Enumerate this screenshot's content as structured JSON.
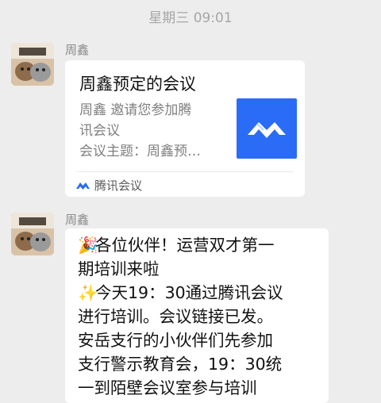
{
  "timestamp": "星期三 09:01",
  "messages": [
    {
      "sender": "周鑫",
      "card": {
        "title": "周鑫预定的会议",
        "desc_lines": [
          "周鑫 邀请您参加腾",
          "讯会议",
          "会议主题：周鑫预…"
        ],
        "source": "腾讯会议",
        "thumb_icon": "tencent-meeting-logo",
        "brand_color": "#2b6cf6"
      }
    },
    {
      "sender": "周鑫",
      "text_lines": [
        {
          "emoji": "🎉",
          "text": "各位伙伴！运营双才第一"
        },
        {
          "emoji": "",
          "text": "期培训来啦"
        },
        {
          "emoji": "✨",
          "text": "今天19：30通过腾讯会议"
        },
        {
          "emoji": "",
          "text": "进行培训。会议链接已发。"
        },
        {
          "emoji": "",
          "text": "安岳支行的小伙伴们先参加"
        },
        {
          "emoji": "",
          "text": "支行警示教育会，19：30统"
        },
        {
          "emoji": "",
          "text": "一到陌壁会议室参与培训"
        }
      ]
    }
  ]
}
